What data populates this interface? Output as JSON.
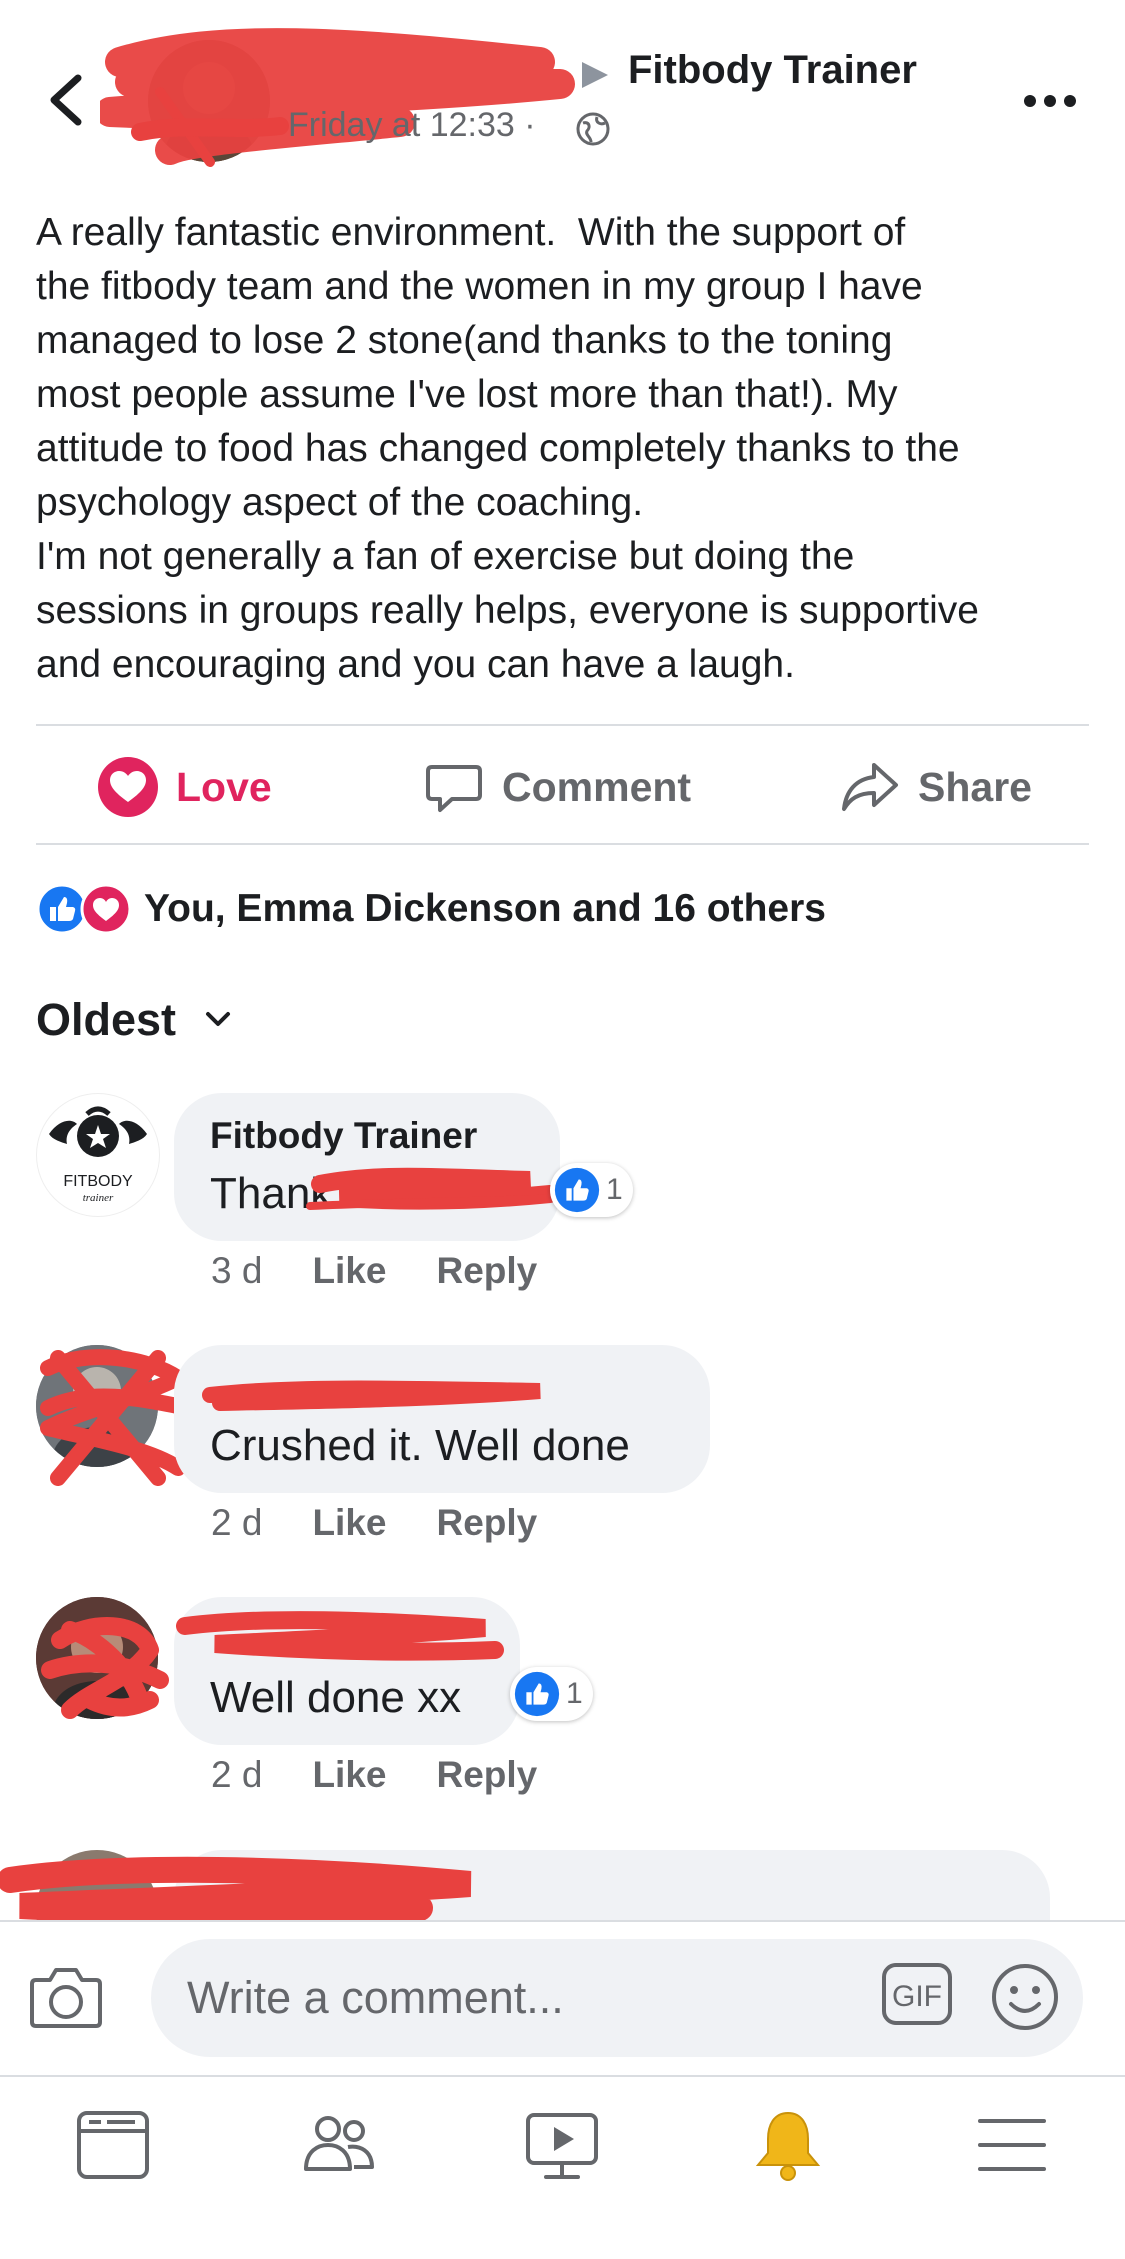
{
  "post": {
    "page_name": "Fitbody Trainer",
    "timestamp": "Friday at 12:33 ·",
    "text": "A really fantastic environment.  With the support of\nthe fitbody team and the women in my group I have\nmanaged to lose 2 stone(and thanks to the toning\nmost people assume I've lost more than that!). My\nattitude to food has changed completely thanks to the\npsychology aspect of the coaching.\nI'm not generally a fan of exercise but doing the\nsessions in groups really helps, everyone is supportive\nand encouraging and you can have a laugh."
  },
  "actions": {
    "love": "Love",
    "comment": "Comment",
    "share": "Share"
  },
  "reactions": {
    "summary": "You, Emma Dickenson and 16 others"
  },
  "sort": {
    "label": "Oldest"
  },
  "comments": [
    {
      "author": "Fitbody Trainer",
      "avatar_text": "FITBODY",
      "avatar_subtext": "trainer",
      "text": "Thank",
      "time": "3 d",
      "like": "Like",
      "reply": "Reply",
      "reaction_count": "1"
    },
    {
      "author": "",
      "text": "Crushed it. Well done",
      "time": "2 d",
      "like": "Like",
      "reply": "Reply"
    },
    {
      "author": "",
      "text": "Well done xx",
      "time": "2 d",
      "like": "Like",
      "reply": "Reply",
      "reaction_count": "1"
    }
  ],
  "composer": {
    "placeholder": "Write a comment...",
    "gif_label": "GIF"
  },
  "tabs": [
    "news-feed",
    "friends",
    "watch",
    "notifications",
    "menu"
  ],
  "colors": {
    "love_red": "#e0245e",
    "like_blue": "#1877f2",
    "redaction": "#e8413f",
    "bell_gold": "#f0b619",
    "secondary_text": "#65676b"
  }
}
